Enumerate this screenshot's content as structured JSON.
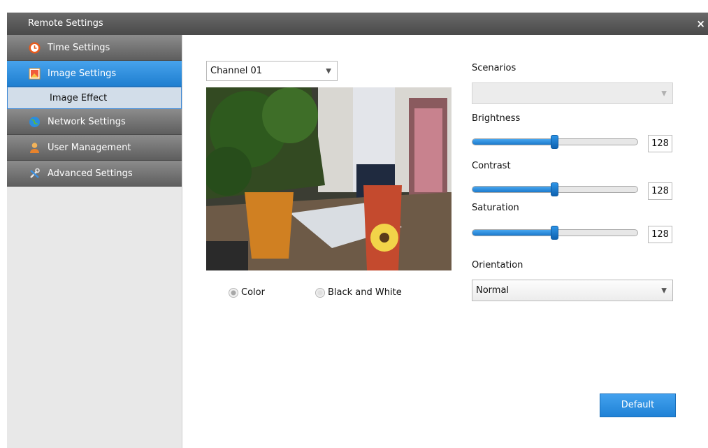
{
  "window": {
    "title": "Remote Settings",
    "close_glyph": "×"
  },
  "sidebar": {
    "items": [
      {
        "label": "Time Settings",
        "icon": "clock-icon"
      },
      {
        "label": "Image Settings",
        "icon": "image-icon",
        "active": true
      },
      {
        "label": "Network Settings",
        "icon": "globe-icon"
      },
      {
        "label": "User Management",
        "icon": "user-icon"
      },
      {
        "label": "Advanced Settings",
        "icon": "tools-icon"
      }
    ],
    "subitem": {
      "label": "Image Effect"
    }
  },
  "channel": {
    "value": "Channel 01"
  },
  "color_mode": {
    "options": [
      "Color",
      "Black and White"
    ],
    "selected": "Color"
  },
  "scenarios": {
    "label": "Scenarios",
    "value": ""
  },
  "brightness": {
    "label": "Brightness",
    "value": "128",
    "level": 128,
    "max": 255
  },
  "contrast": {
    "label": "Contrast",
    "value": "128",
    "level": 128,
    "max": 255
  },
  "saturation": {
    "label": "Saturation",
    "value": "128",
    "level": 128,
    "max": 255
  },
  "orientation": {
    "label": "Orientation",
    "value": "Normal"
  },
  "buttons": {
    "default_label": "Default"
  },
  "colors": {
    "accent": "#2389dc",
    "titlebar": "#595959",
    "sidebar_bg": "#e8e8e8"
  }
}
